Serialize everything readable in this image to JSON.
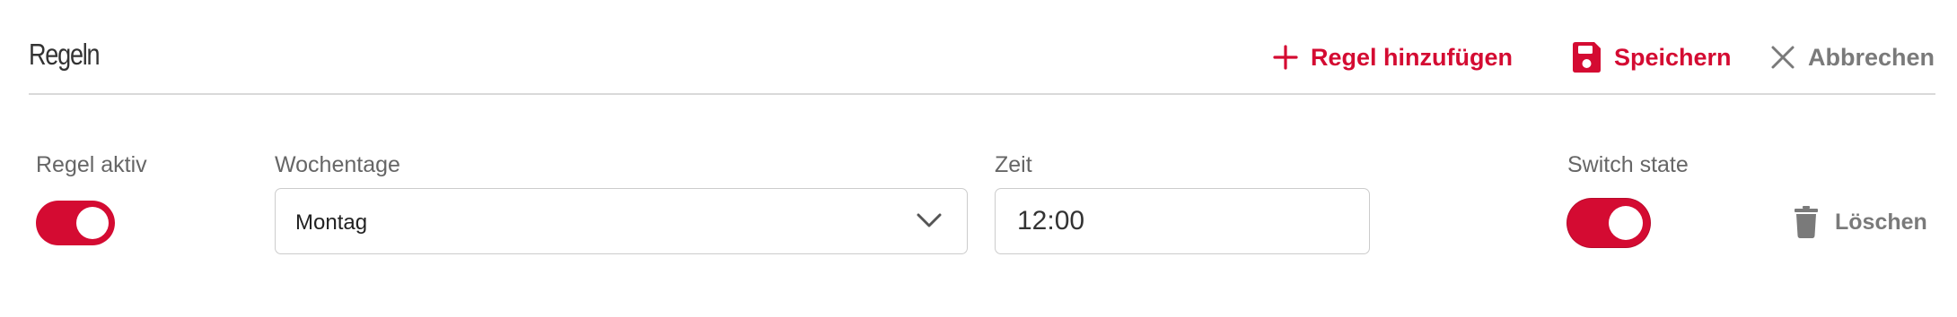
{
  "header": {
    "title": "Regeln",
    "add_rule_label": "Regel hinzufügen",
    "save_label": "Speichern",
    "cancel_label": "Abbrechen"
  },
  "rule": {
    "active_label": "Regel aktiv",
    "active_on": true,
    "weekdays_label": "Wochentage",
    "weekdays_value": "Montag",
    "time_label": "Zeit",
    "time_value": "12:00",
    "switch_state_label": "Switch state",
    "switch_state_on": true,
    "delete_label": "Löschen"
  },
  "colors": {
    "accent": "#d40b32",
    "muted": "#7a7a7a",
    "divider": "#d9d9d9"
  },
  "icons": {
    "add": "plus-icon",
    "save": "floppy-disk-icon",
    "cancel": "close-icon",
    "select": "chevron-down-icon",
    "delete": "trash-icon"
  }
}
